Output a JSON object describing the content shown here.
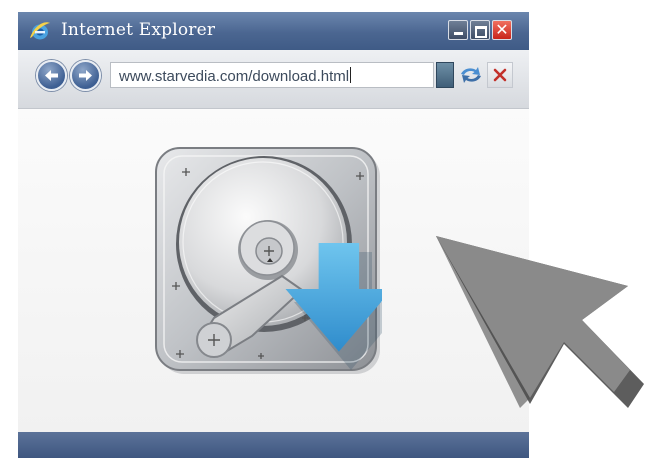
{
  "window": {
    "title": "Internet Explorer",
    "icon": "ie-logo-icon",
    "controls": [
      "minimize-icon",
      "maximize-icon",
      "close-icon"
    ]
  },
  "toolbar": {
    "address": "www.starvedia.com/download.html",
    "buttons": [
      "back-arrow-icon",
      "forward-arrow-icon",
      "go-icon",
      "refresh-icon",
      "stop-icon"
    ]
  },
  "content": {
    "illustration": "hard-drive-icon",
    "overlay": "download-arrow-icon",
    "pointer": "mouse-cursor-icon"
  },
  "colors": {
    "titlebar": "#4b6691",
    "statusbar": "#4a6189",
    "download_arrow": "#4aa8de",
    "cursor": "#7c7c7c"
  }
}
